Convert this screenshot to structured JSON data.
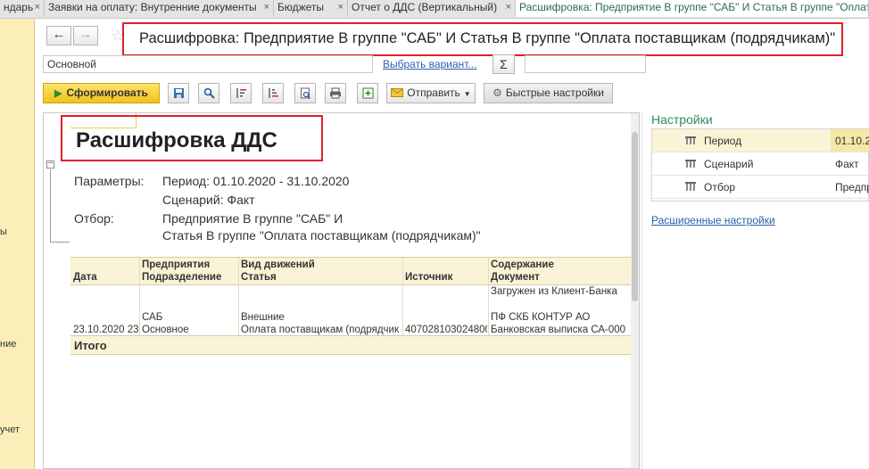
{
  "tabs": [
    {
      "label": "ндарь"
    },
    {
      "label": "Заявки на оплату: Внутренние документы"
    },
    {
      "label": "Бюджеты"
    },
    {
      "label": "Отчет о ДДС (Вертикальный)"
    },
    {
      "label": "Расшифровка: Предприятие В группе \"САБ\" И Статья В группе \"Оплата"
    }
  ],
  "tab_close": "×",
  "sidebar": {
    "labels": [
      "ы",
      "ние",
      "учет"
    ]
  },
  "nav": {
    "back": "←",
    "forward": "→",
    "star": "☆"
  },
  "window_title": "Расшифровка: Предприятие В группе \"САБ\" И Статья В группе \"Оплата поставщикам (подрядчикам)\"",
  "variant": {
    "value": "Основной",
    "choose_link": "Выбрать вариант...",
    "sum_symbol": "Σ"
  },
  "toolbar": {
    "generate": "Сформировать",
    "send": "Отправить",
    "quick_settings": "Быстрые настройки"
  },
  "report": {
    "title": "Расшифровка ДДС",
    "params_label": "Параметры:",
    "period": "Период: 01.10.2020 - 31.10.2020",
    "scenario": "Сценарий: Факт",
    "filter_label": "Отбор:",
    "filter_line1": "Предприятие В группе \"САБ\" И",
    "filter_line2": "Статья В группе \"Оплата поставщикам (подрядчикам)\"",
    "columns": [
      {
        "line1": "",
        "line2": "Дата"
      },
      {
        "line1": "Предприятия",
        "line2": "Подразделение"
      },
      {
        "line1": "Вид движений",
        "line2": "Статья"
      },
      {
        "line1": "",
        "line2": "Источник"
      },
      {
        "line1": "Содержание",
        "line2": "Документ"
      }
    ],
    "row": {
      "date": "23.10.2020 23",
      "enterprise": "САБ",
      "division": "Основное",
      "movement": "Внешние",
      "article": "Оплата поставщикам (подрядчик",
      "source": "407028103024800",
      "content_line1": "Загружен из Клиент-Банка",
      "content_line2": "ПФ СКБ КОНТУР АО",
      "document": "Банковская выписка СА-000"
    },
    "total": "Итого"
  },
  "settings": {
    "title": "Настройки",
    "rows": [
      {
        "name": "Период",
        "value": "01.10.2"
      },
      {
        "name": "Сценарий",
        "value": "Факт"
      },
      {
        "name": "Отбор",
        "value": "Предпр"
      }
    ],
    "advanced_link": "Расширенные настройки"
  }
}
